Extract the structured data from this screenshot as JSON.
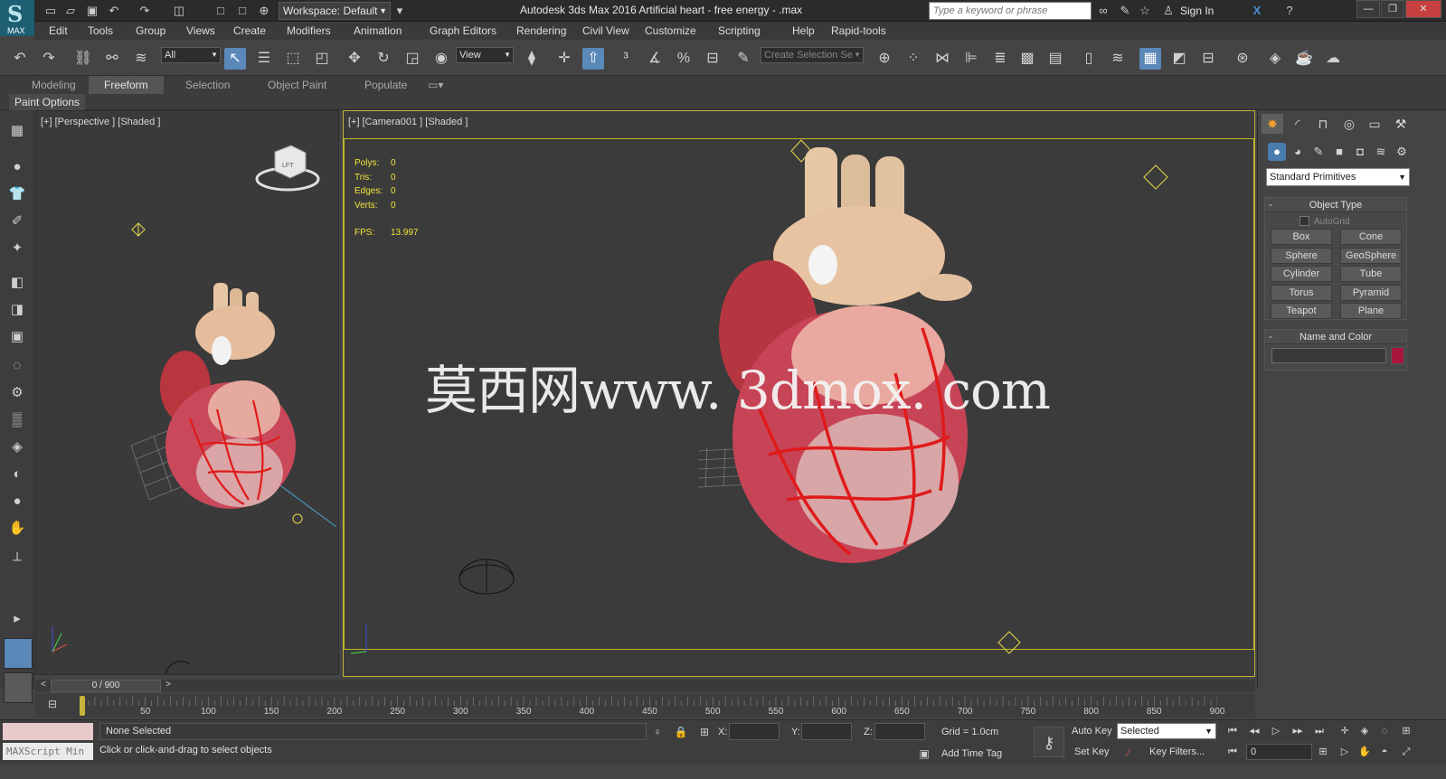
{
  "titlebar": {
    "logo_text": "MAX",
    "workspace": "Workspace: Default",
    "title": "Autodesk 3ds Max 2016    Artificial heart - free energy - .max",
    "search_placeholder": "Type a keyword or phrase",
    "sign_in": "Sign In"
  },
  "menu": [
    "Edit",
    "Tools",
    "Group",
    "Views",
    "Create",
    "Modifiers",
    "Animation",
    "Graph Editors",
    "Rendering",
    "Civil View",
    "Customize",
    "Scripting",
    "Help",
    "Rapid-tools"
  ],
  "toolbar": {
    "filter_value": "All",
    "refcoord_value": "View",
    "selection_set_placeholder": "Create Selection Se"
  },
  "ribbon": {
    "tabs": [
      "Modeling",
      "Freeform",
      "Selection",
      "Object Paint",
      "Populate"
    ],
    "active_tab": "Freeform",
    "sub_label": "Paint Options"
  },
  "viewports": {
    "left_label": "[+] [Perspective ] [Shaded ]",
    "right_label": "[+] [Camera001 ] [Shaded ]",
    "viewcube_text": "LFT"
  },
  "stats": {
    "polys_label": "Polys:",
    "polys": "0",
    "tris_label": "Tris:",
    "tris": "0",
    "edges_label": "Edges:",
    "edges": "0",
    "verts_label": "Verts:",
    "verts": "0",
    "fps_label": "FPS:",
    "fps": "13.997"
  },
  "watermark": "莫西网www. 3dmox. com",
  "command_panel": {
    "category": "Standard Primitives",
    "object_type_title": "Object Type",
    "autogrid": "AutoGrid",
    "primitives": [
      "Box",
      "Cone",
      "Sphere",
      "GeoSphere",
      "Cylinder",
      "Tube",
      "Torus",
      "Pyramid",
      "Teapot",
      "Plane"
    ],
    "name_color_title": "Name and Color",
    "object_color": "#a8153d"
  },
  "timeline": {
    "frame_counter": "0 / 900",
    "prev": "<",
    "next": ">",
    "ticks": [
      "50",
      "100",
      "150",
      "200",
      "250",
      "300",
      "350",
      "400",
      "450",
      "500",
      "550",
      "600",
      "650",
      "700",
      "750",
      "800",
      "850",
      "900"
    ]
  },
  "status": {
    "maxscript": "MAXScript Min",
    "selection": "None Selected",
    "prompt": "Click or click-and-drag to select objects",
    "x_label": "X:",
    "y_label": "Y:",
    "z_label": "Z:",
    "grid": "Grid = 1.0cm",
    "add_time_tag": "Add Time Tag",
    "auto_key": "Auto Key",
    "set_key": "Set Key",
    "key_mode": "Selected",
    "key_filters": "Key Filters...",
    "current_frame": "0"
  },
  "colors": {
    "safe_frame": "#c4b81e",
    "stats_text": "#f2e33c",
    "active_tool": "#5a88b8"
  }
}
